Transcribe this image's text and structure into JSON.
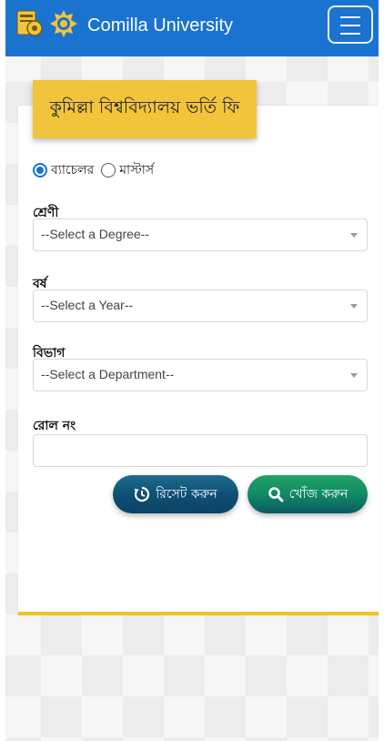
{
  "navbar": {
    "brand": "Comilla University",
    "bg_color": "#1a73cf"
  },
  "card": {
    "title": "কুমিল্লা বিশ্ববিদ্যালয় ভর্তি ফি",
    "accent_color": "#f1c43c"
  },
  "program": {
    "options": [
      {
        "label": "ব্যাচেলর",
        "selected": true
      },
      {
        "label": "মাস্টার্স",
        "selected": false
      }
    ]
  },
  "fields": {
    "degree": {
      "label": "শ্রেণী",
      "value": "--Select a Degree--"
    },
    "year": {
      "label": "বর্ষ",
      "value": "--Select a Year--"
    },
    "department": {
      "label": "বিভাগ",
      "value": "--Select a Department--"
    },
    "roll": {
      "label": "রোল নং",
      "value": ""
    }
  },
  "buttons": {
    "reset": {
      "label": "রিসেট করুন",
      "icon": "history-icon"
    },
    "search": {
      "label": "খোঁজ করুন",
      "icon": "search-icon"
    }
  }
}
